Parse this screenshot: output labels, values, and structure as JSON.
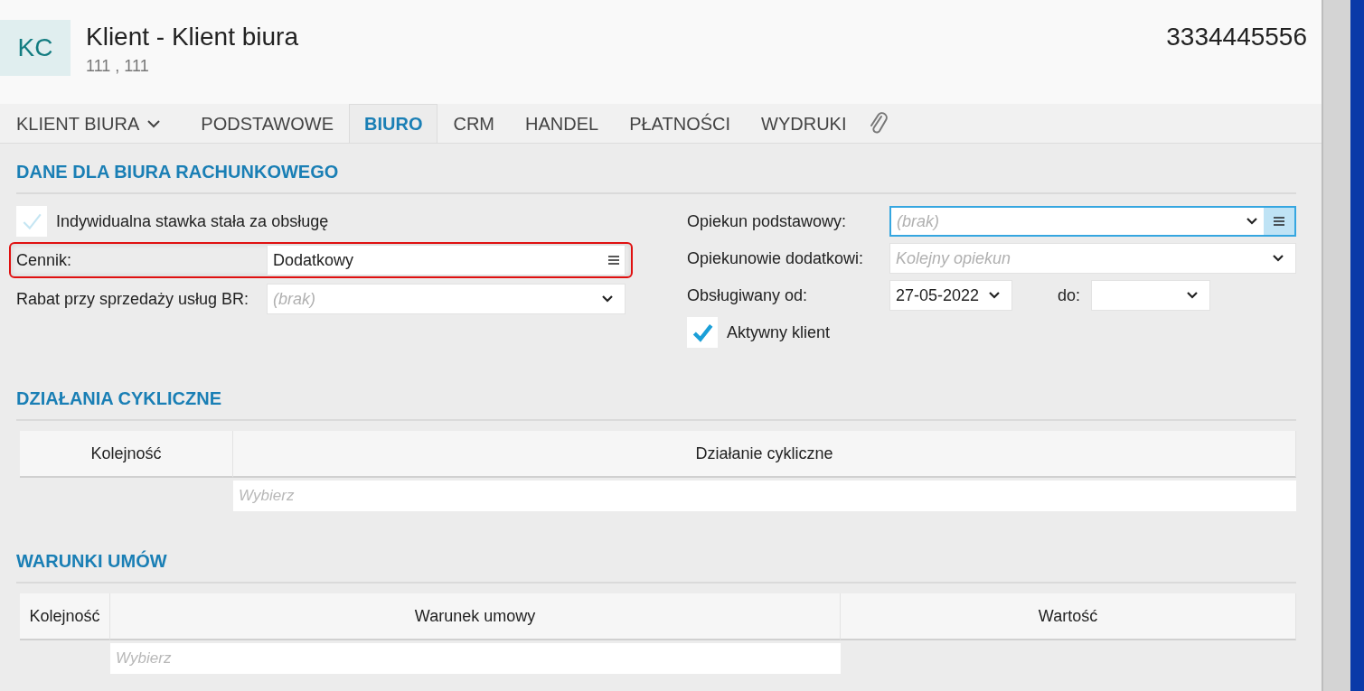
{
  "header": {
    "initials": "KC",
    "title": "Klient - Klient biura",
    "subtitle": "111 , 111",
    "phone": "3334445556"
  },
  "tabs": [
    {
      "kind": "dropdown",
      "label": "KLIENT BIURA",
      "selected": false
    },
    {
      "kind": "text",
      "label": "PODSTAWOWE",
      "selected": false
    },
    {
      "kind": "text",
      "label": "BIURO",
      "selected": true
    },
    {
      "kind": "text",
      "label": "CRM",
      "selected": false
    },
    {
      "kind": "text",
      "label": "HANDEL",
      "selected": false
    },
    {
      "kind": "text",
      "label": "PŁATNOŚCI",
      "selected": false
    },
    {
      "kind": "text",
      "label": "WYDRUKI",
      "selected": false
    },
    {
      "kind": "attachment",
      "selected": false
    }
  ],
  "office": {
    "heading": "DANE DLA BIURA RACHUNKOWEGO",
    "left": [
      {
        "kind": "checkbox",
        "label": "Indywidualna stawka stała za obsługę",
        "checked": false
      },
      {
        "kind": "list",
        "label": "Cennik:",
        "value": "Dodatkowy",
        "highlighted": true
      },
      {
        "kind": "select",
        "label": "Rabat przy sprzedaży usług BR:",
        "placeholder": "(brak)",
        "focused": false
      }
    ],
    "right": [
      {
        "kind": "select-list",
        "label": "Opiekun podstawowy:",
        "placeholder": "(brak)",
        "focused": true
      },
      {
        "kind": "select",
        "label": "Opiekunowie dodatkowi:",
        "placeholder": "Kolejny opiekun",
        "focused": false
      },
      {
        "kind": "daterange",
        "label": "Obsługiwany od:",
        "from": "27-05-2022",
        "to_label": "do:"
      },
      {
        "kind": "checkbox",
        "label": "Aktywny klient",
        "checked": true
      }
    ]
  },
  "tables": [
    {
      "heading": "DZIAŁANIA CYKLICZNE",
      "columns": [
        "Kolejność",
        "Działanie cykliczne"
      ],
      "placeholder": "Wybierz"
    },
    {
      "heading": "WARUNKI UMÓW",
      "columns": [
        "Kolejność",
        "Warunek umowy",
        "Wartość"
      ],
      "placeholder": "Wybierz"
    }
  ]
}
